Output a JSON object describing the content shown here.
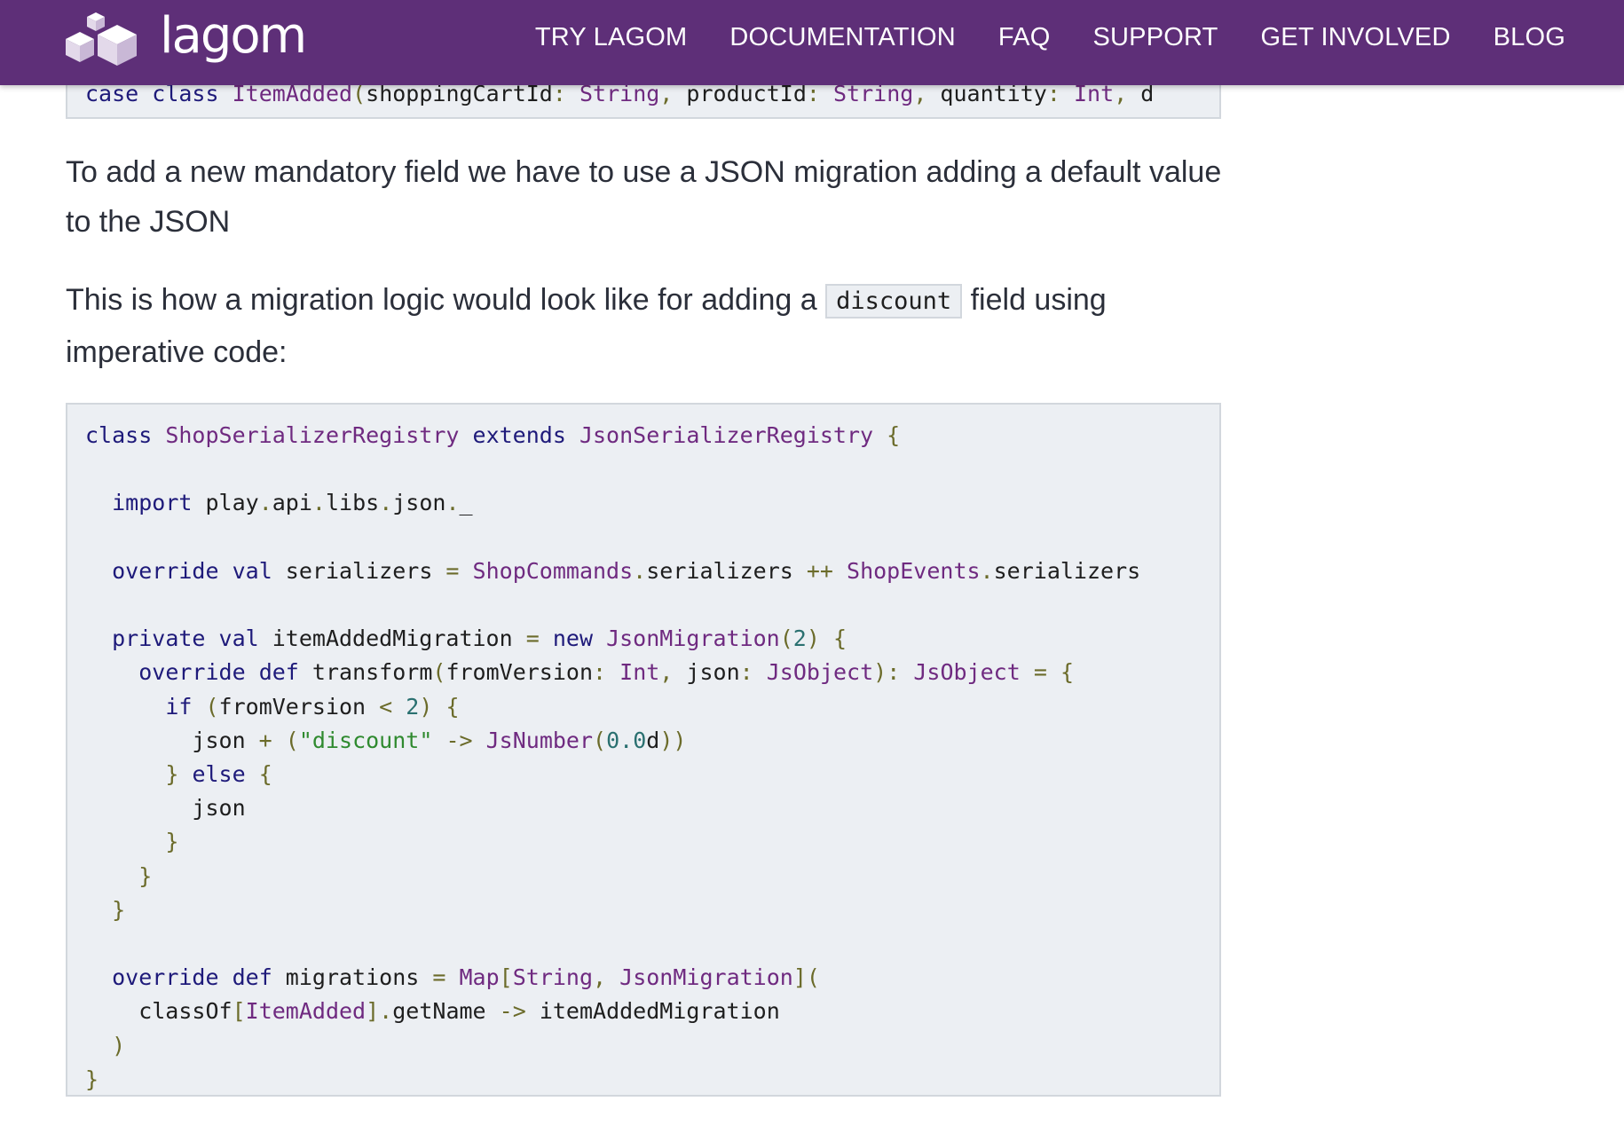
{
  "header": {
    "logo_text": "lagom",
    "nav": [
      "TRY LAGOM",
      "DOCUMENTATION",
      "FAQ",
      "SUPPORT",
      "GET INVOLVED",
      "BLOG"
    ]
  },
  "content": {
    "paragraph1": "To add a new mandatory field we have to use a JSON migration adding a default value to the JSON",
    "paragraph2_before": "This is how a migration logic would look like for adding a",
    "paragraph2_code": "discount",
    "paragraph2_after": "field using imperative code:",
    "top_code_line": "case class ItemAdded(shoppingCartId: String, productId: String, quantity: Int, d",
    "code_lines": [
      "class ShopSerializerRegistry extends JsonSerializerRegistry {",
      "",
      "  import play.api.libs.json._",
      "",
      "  override val serializers = ShopCommands.serializers ++ ShopEvents.serializers",
      "",
      "  private val itemAddedMigration = new JsonMigration(2) {",
      "    override def transform(fromVersion: Int, json: JsObject): JsObject = {",
      "      if (fromVersion < 2) {",
      "        json + (\"discount\" -> JsNumber(0.0d))",
      "      } else {",
      "        json",
      "      }",
      "    }",
      "  }",
      "",
      "  override def migrations = Map[String, JsonMigration](",
      "    classOf[ItemAdded].getName -> itemAddedMigration",
      "  )",
      "}"
    ]
  }
}
